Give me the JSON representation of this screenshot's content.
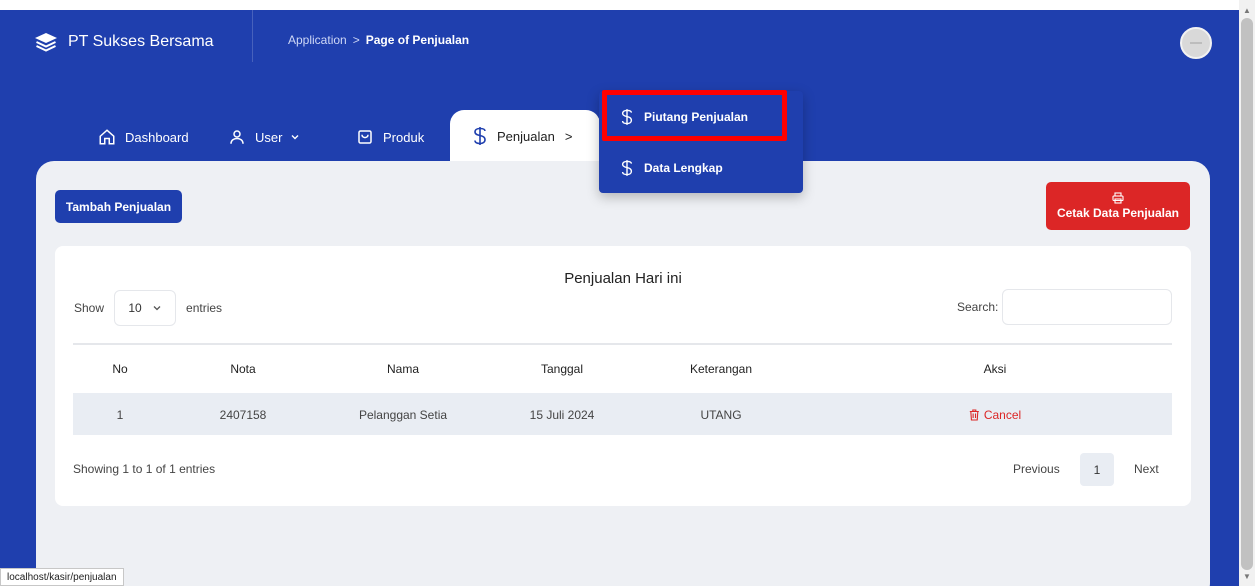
{
  "header": {
    "brand": "PT Sukses Bersama",
    "breadcrumb": {
      "root": "Application",
      "separator": ">",
      "current": "Page of Penjualan"
    },
    "avatar_icon": "avatar-icon"
  },
  "nav": {
    "items": [
      {
        "label": "Dashboard",
        "icon": "home-icon"
      },
      {
        "label": "User",
        "icon": "user-icon"
      },
      {
        "label": "Produk",
        "icon": "shopping-bag-icon"
      },
      {
        "label": "Penjualan",
        "icon": "dollar-icon",
        "chevron": ">"
      }
    ]
  },
  "dropdown": {
    "items": [
      {
        "label": "Piutang Penjualan",
        "icon": "dollar-icon"
      },
      {
        "label": "Data Lengkap",
        "icon": "dollar-icon"
      }
    ],
    "highlight_color": "#ff0000"
  },
  "actions": {
    "tambah": "Tambah Penjualan",
    "cetak": "Cetak Data Penjualan"
  },
  "table": {
    "title": "Penjualan Hari ini",
    "show_label": "Show",
    "entries_value": "10",
    "entries_label": "entries",
    "search_label": "Search:",
    "columns": [
      "No",
      "Nota",
      "Nama",
      "Tanggal",
      "Keterangan",
      "Aksi"
    ],
    "rows": [
      {
        "no": "1",
        "nota": "2407158",
        "nama": "Pelanggan Setia",
        "tanggal": "15 Juli 2024",
        "keterangan": "UTANG",
        "aksi": "Cancel"
      }
    ],
    "showing": "Showing 1 to 1 of 1 entries",
    "pagination": {
      "previous": "Previous",
      "page": "1",
      "next": "Next"
    }
  },
  "status_bar": "localhost/kasir/penjualan",
  "colors": {
    "primary": "#1f3fae",
    "danger": "#dc2626"
  }
}
